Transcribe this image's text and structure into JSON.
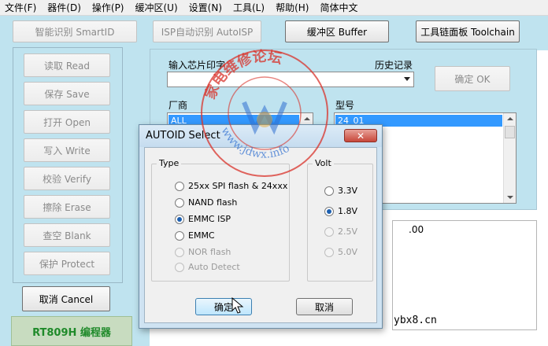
{
  "menu": [
    "文件(F)",
    "器件(D)",
    "操作(P)",
    "缓冲区(U)",
    "设置(N)",
    "工具(L)",
    "帮助(H)",
    "简体中文"
  ],
  "toolbar": {
    "smartid": "智能识别 SmartID",
    "autoisp": "ISP自动识别 AutoISP",
    "buffer": "缓冲区 Buffer",
    "toolchain": "工具链面板 Toolchain"
  },
  "left_buttons": [
    "读取 Read",
    "保存 Save",
    "打开 Open",
    "写入 Write",
    "校验 Verify",
    "擦除 Erase",
    "查空 Blank",
    "保护 Protect"
  ],
  "cancel_label": "取消 Cancel",
  "brand": "RT809H 编程器",
  "right": {
    "chip_input_label": "输入芯片印字",
    "history_label": "历史记录",
    "ok_label": "确定 OK",
    "vendor_label": "厂商",
    "vendor_selected": "ALL",
    "model_label": "型号",
    "model_selected": "24_01"
  },
  "log": {
    "fragment": ".00"
  },
  "dialog": {
    "title": "AUTOID Select",
    "close_label": "✕",
    "type_group": "Type",
    "type_options": [
      {
        "label": "25xx SPI flash & 24xxx",
        "checked": false,
        "enabled": true
      },
      {
        "label": "NAND flash",
        "checked": false,
        "enabled": true
      },
      {
        "label": "EMMC ISP",
        "checked": true,
        "enabled": true
      },
      {
        "label": "EMMC",
        "checked": false,
        "enabled": true
      },
      {
        "label": "NOR flash",
        "checked": false,
        "enabled": false
      },
      {
        "label": "Auto Detect",
        "checked": false,
        "enabled": false
      }
    ],
    "volt_group": "Volt",
    "volt_options": [
      {
        "label": "3.3V",
        "checked": false,
        "enabled": true
      },
      {
        "label": "1.8V",
        "checked": true,
        "enabled": true
      },
      {
        "label": "2.5V",
        "checked": false,
        "enabled": false
      },
      {
        "label": "5.0V",
        "checked": false,
        "enabled": false
      }
    ],
    "ok_label": "确定",
    "cancel_label": "取消"
  },
  "watermark": {
    "ring_text": "家电维修论坛",
    "url": "www.jdwx.info",
    "footer": "ybx8.cn"
  },
  "colors": {
    "panel_bg": "#bfe3ef",
    "selection": "#3399ff",
    "brand_text": "#1f8a2a",
    "watermark_red": "#d9332b"
  }
}
